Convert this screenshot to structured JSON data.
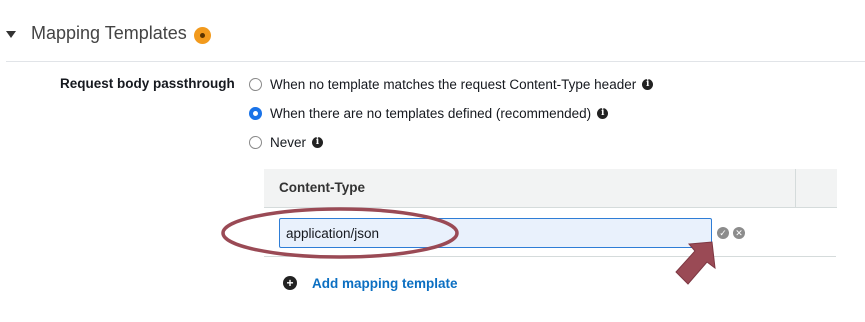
{
  "section": {
    "title": "Mapping Templates"
  },
  "passthrough": {
    "label": "Request body passthrough",
    "options": [
      {
        "label": "When no template matches the request Content-Type header",
        "selected": false
      },
      {
        "label": "When there are no templates defined (recommended)",
        "selected": true
      },
      {
        "label": "Never",
        "selected": false
      }
    ]
  },
  "table": {
    "column": "Content-Type",
    "input_value": "application/json"
  },
  "add": {
    "label": "Add mapping template"
  },
  "colors": {
    "accent": "#1a73e8",
    "link": "#0b6fc2",
    "warning": "#f29a1d",
    "annotation": "#9a4a55"
  },
  "icons": {
    "caret": "caret-down-icon",
    "warning": "warning-dot-icon",
    "info": "info-icon",
    "ok": "check-circle-icon",
    "cancel": "close-circle-icon",
    "add": "plus-circle-icon"
  }
}
